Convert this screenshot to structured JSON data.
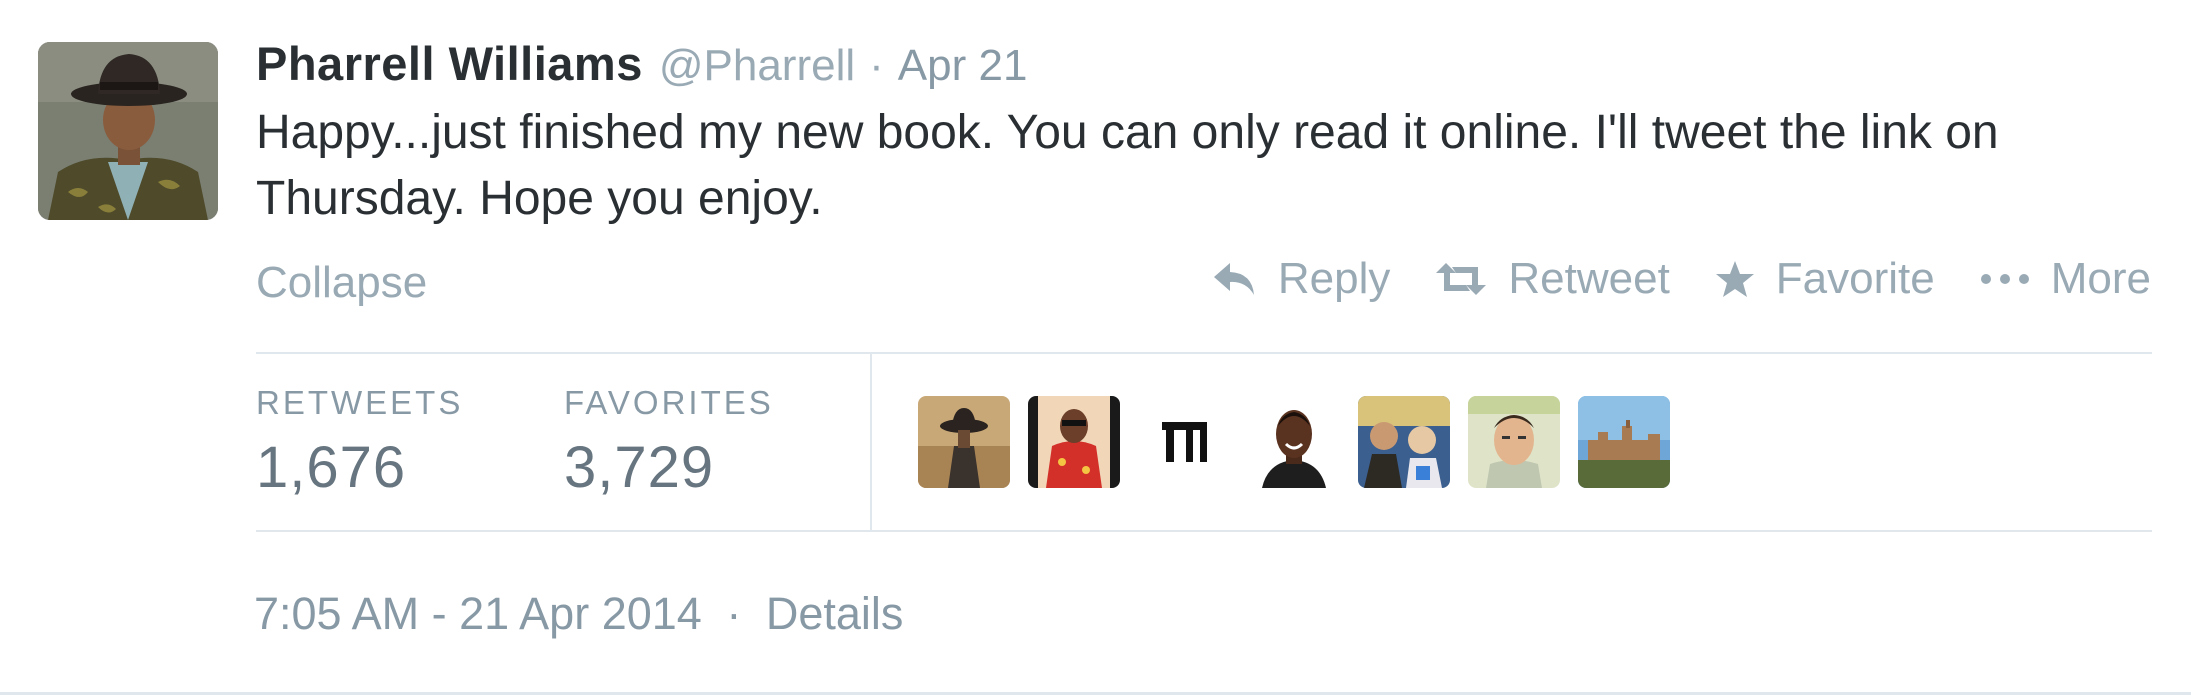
{
  "tweet": {
    "author": {
      "fullname": "Pharrell Williams",
      "username": "@Pharrell"
    },
    "date": "Apr 21",
    "separator": "·",
    "text": "Happy...just finished my new book. You can only read it online. I'll tweet the link on Thursday. Hope you enjoy.",
    "collapse_label": "Collapse",
    "actions": {
      "reply": {
        "label": "Reply",
        "icon": "reply-icon"
      },
      "retweet": {
        "label": "Retweet",
        "icon": "retweet-icon"
      },
      "favorite": {
        "label": "Favorite",
        "icon": "star-icon"
      },
      "more": {
        "label": "More",
        "icon": "more-dots-icon"
      }
    },
    "stats": {
      "retweets_label": "RETWEETS",
      "retweets_count": "1,676",
      "favorites_label": "FAVORITES",
      "favorites_count": "3,729"
    },
    "favoriter_avatars": [
      "avatar-hat-figure",
      "avatar-red-shirt",
      "avatar-logo-glyph",
      "avatar-smiling-kid",
      "avatar-group-photo",
      "avatar-young-man",
      "avatar-castle-landscape"
    ],
    "timestamp": "7:05 AM - 21 Apr 2014",
    "details_label": "Details"
  },
  "colors": {
    "text_primary": "#292f33",
    "text_muted": "#99aab5",
    "text_meta": "#8899a6",
    "border": "#e1e8ed"
  }
}
